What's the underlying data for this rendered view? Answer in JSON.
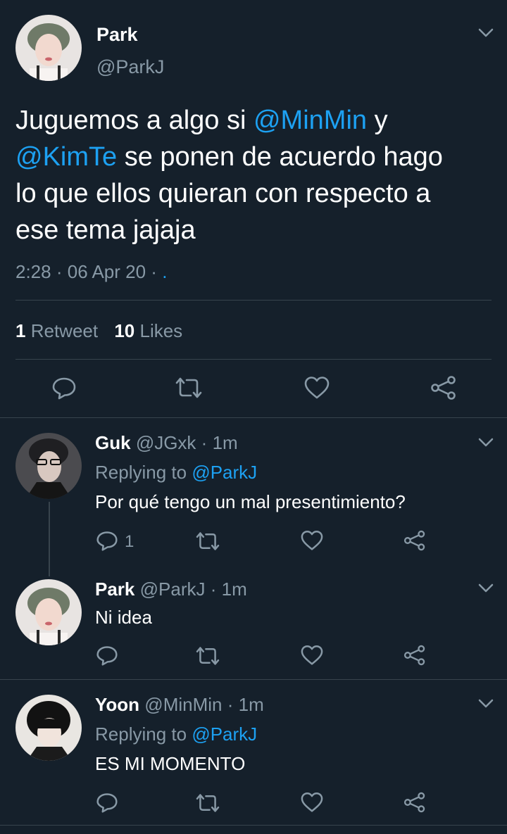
{
  "main_tweet": {
    "name": "Park",
    "handle": "@ParkJ",
    "text_parts": [
      "Juguemos a algo si ",
      "@MinMin",
      " y",
      "@KimTe",
      " se ponen de acuerdo hago",
      "lo que ellos quieran con respecto a",
      "ese tema jajaja"
    ],
    "time": "2:28",
    "date": "06 Apr 20",
    "source": ".",
    "retweets_count": "1",
    "retweets_label": "Retweet",
    "likes_count": "10",
    "likes_label": "Likes"
  },
  "replies": [
    {
      "name": "Guk",
      "handle": "@JGxk",
      "time": "1m",
      "replying_prefix": "Replying to",
      "replying_to": "@ParkJ",
      "text": "Por qué tengo un mal presentimiento?",
      "reply_count": "1"
    },
    {
      "name": "Park",
      "handle": "@ParkJ",
      "time": "1m",
      "text": "Ni idea"
    },
    {
      "name": "Yoon",
      "handle": "@MinMin",
      "time": "1m",
      "replying_prefix": "Replying to",
      "replying_to": "@ParkJ",
      "text": "ES MI MOMENTO"
    }
  ],
  "separators": {
    "dot": "·"
  },
  "icons": [
    "chevron-down-icon",
    "reply-icon",
    "retweet-icon",
    "like-icon",
    "share-icon"
  ],
  "colors": {
    "background": "#15202b",
    "accent": "#1da1f2",
    "muted": "#8899a6",
    "divider": "#38444d"
  }
}
